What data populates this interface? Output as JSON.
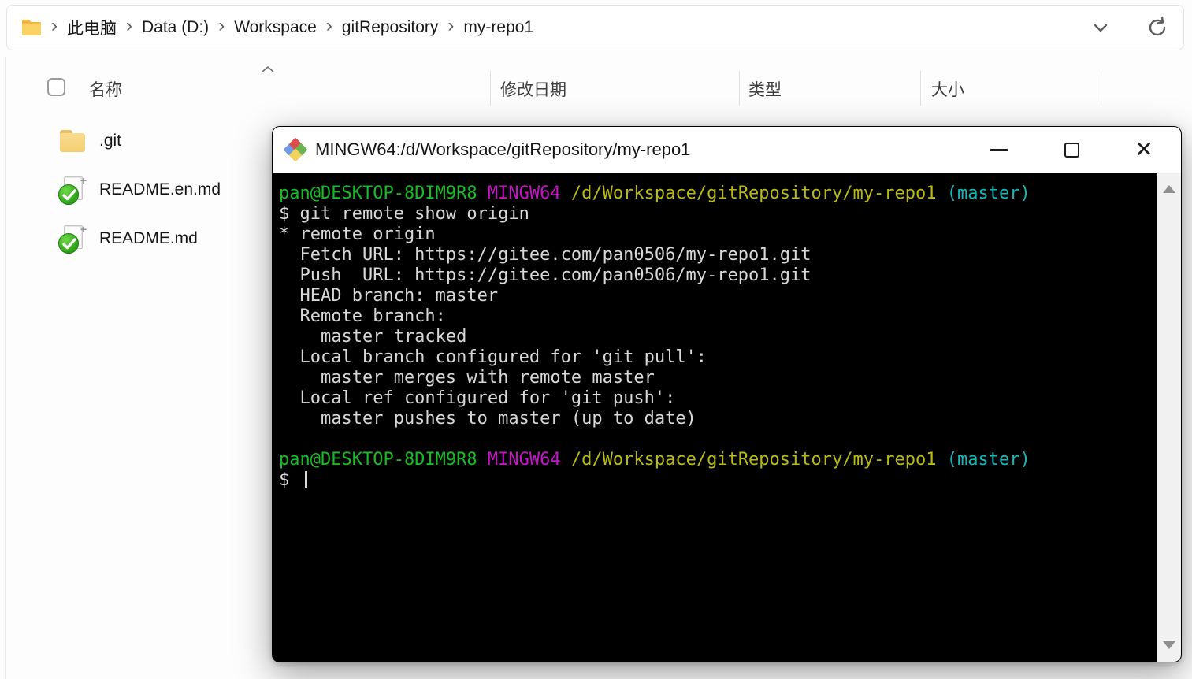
{
  "icons": {
    "breadcrumb_separator": "›",
    "close_glyph": "✕",
    "file_plus_overlay": "+"
  },
  "explorer": {
    "breadcrumb": {
      "items": [
        "此电脑",
        "Data (D:)",
        "Workspace",
        "gitRepository",
        "my-repo1"
      ]
    },
    "columns": [
      "名称",
      "修改日期",
      "类型",
      "大小"
    ],
    "files": [
      {
        "name": ".git",
        "icon": "folder"
      },
      {
        "name": "README.en.md",
        "icon": "file-check"
      },
      {
        "name": "README.md",
        "icon": "file-check"
      }
    ]
  },
  "terminal": {
    "title": "MINGW64:/d/Workspace/gitRepository/my-repo1",
    "colors": {
      "green": "#16bb26",
      "magenta": "#c513c5",
      "yellow": "#b9ba14",
      "cyan": "#0fb9b9",
      "plain": "#d8d8d8",
      "background": "#000000"
    },
    "lines": [
      {
        "segments": [
          {
            "c": "green",
            "t": "pan@DESKTOP-8DIM9R8"
          },
          {
            "c": "plain",
            "t": " "
          },
          {
            "c": "magenta",
            "t": "MINGW64"
          },
          {
            "c": "plain",
            "t": " "
          },
          {
            "c": "yellow",
            "t": "/d/Workspace/gitRepository/my-repo1"
          },
          {
            "c": "plain",
            "t": " "
          },
          {
            "c": "cyan",
            "t": "(master)"
          }
        ]
      },
      {
        "segments": [
          {
            "c": "plain",
            "t": "$ git remote show origin"
          }
        ]
      },
      {
        "segments": [
          {
            "c": "plain",
            "t": "* remote origin"
          }
        ]
      },
      {
        "segments": [
          {
            "c": "plain",
            "t": "  Fetch URL: https://gitee.com/pan0506/my-repo1.git"
          }
        ]
      },
      {
        "segments": [
          {
            "c": "plain",
            "t": "  Push  URL: https://gitee.com/pan0506/my-repo1.git"
          }
        ]
      },
      {
        "segments": [
          {
            "c": "plain",
            "t": "  HEAD branch: master"
          }
        ]
      },
      {
        "segments": [
          {
            "c": "plain",
            "t": "  Remote branch:"
          }
        ]
      },
      {
        "segments": [
          {
            "c": "plain",
            "t": "    master tracked"
          }
        ]
      },
      {
        "segments": [
          {
            "c": "plain",
            "t": "  Local branch configured for 'git pull':"
          }
        ]
      },
      {
        "segments": [
          {
            "c": "plain",
            "t": "    master merges with remote master"
          }
        ]
      },
      {
        "segments": [
          {
            "c": "plain",
            "t": "  Local ref configured for 'git push':"
          }
        ]
      },
      {
        "segments": [
          {
            "c": "plain",
            "t": "    master pushes to master (up to date)"
          }
        ]
      },
      {
        "segments": []
      },
      {
        "segments": [
          {
            "c": "green",
            "t": "pan@DESKTOP-8DIM9R8"
          },
          {
            "c": "plain",
            "t": " "
          },
          {
            "c": "magenta",
            "t": "MINGW64"
          },
          {
            "c": "plain",
            "t": " "
          },
          {
            "c": "yellow",
            "t": "/d/Workspace/gitRepository/my-repo1"
          },
          {
            "c": "plain",
            "t": " "
          },
          {
            "c": "cyan",
            "t": "(master)"
          }
        ]
      },
      {
        "segments": [
          {
            "c": "plain",
            "t": "$ "
          },
          {
            "c": "cursor",
            "t": ""
          }
        ]
      }
    ]
  }
}
